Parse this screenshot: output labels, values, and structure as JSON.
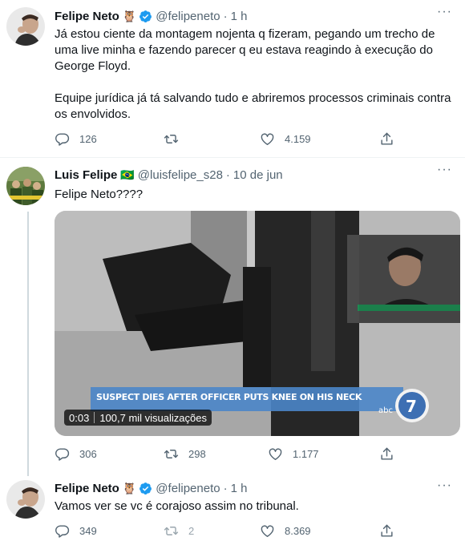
{
  "tweets": [
    {
      "name": "Felipe Neto",
      "emoji": "🦉",
      "handle": "@felipeneto",
      "time": "1 h",
      "text1": "Já estou ciente da montagem nojenta q fizeram, pegando um trecho de uma live minha e fazendo parecer q eu estava reagindo à execução do George Floyd.",
      "text2": "Equipe jurídica já tá salvando tudo e abriremos processos criminais contra os envolvidos.",
      "replies": "126",
      "retweets": "",
      "likes": "4.159"
    },
    {
      "name": "Luis Felipe",
      "emoji": "🇧🇷",
      "handle": "@luisfelipe_s28",
      "time": "10 de jun",
      "text": "Felipe Neto????",
      "video_caption": "SUSPECT DIES AFTER OFFICER PUTS KNEE ON HIS NECK",
      "video_duration": "0:03",
      "video_views": "100,7 mil visualizações",
      "replies": "306",
      "retweets": "298",
      "likes": "1.177"
    },
    {
      "name": "Felipe Neto",
      "emoji": "🦉",
      "handle": "@felipeneto",
      "time": "1 h",
      "text": "Vamos ver se vc é corajoso assim no tribunal.",
      "replies": "349",
      "retweets": "2",
      "likes": "8.369"
    }
  ],
  "separator": "·",
  "more_label": "···",
  "colors": {
    "verified": "#1d9bf0",
    "text": "#0f1419",
    "muted": "#536471",
    "divider": "#eff3f4"
  },
  "icons": [
    "reply-icon",
    "retweet-icon",
    "like-icon",
    "share-icon",
    "verified-badge-icon",
    "more-icon"
  ]
}
